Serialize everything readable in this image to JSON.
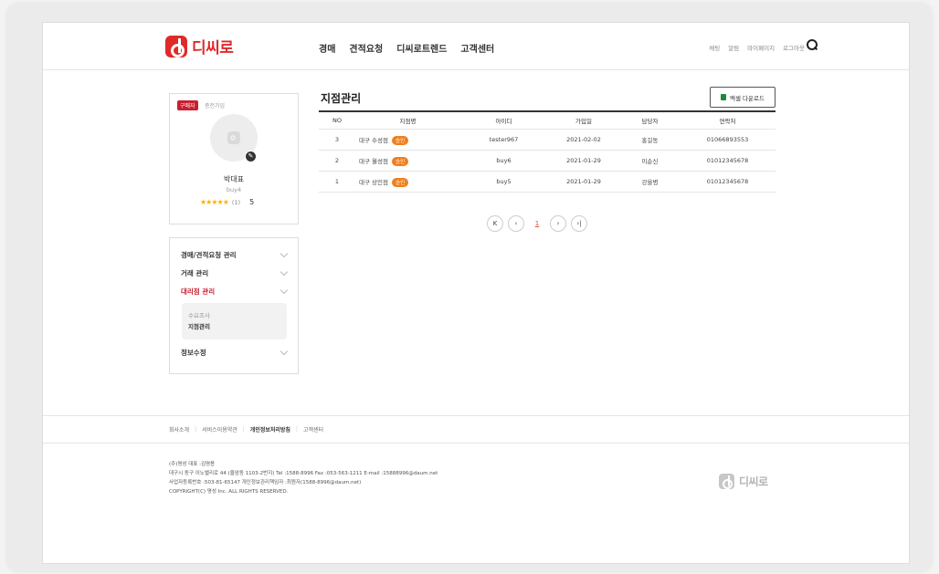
{
  "brand": {
    "name": "디씨로"
  },
  "nav": {
    "items": [
      "경매",
      "견적요청",
      "디씨로트렌드",
      "고객센터"
    ]
  },
  "util": {
    "items": [
      "채팅",
      "알림",
      "마이페이지",
      "로그아웃"
    ]
  },
  "profile": {
    "badge": "구매자",
    "type": "종전가입",
    "name": "박대표",
    "id": "buy4",
    "stars": "★★★★★",
    "rating_count": "(1)",
    "rating_score": "5"
  },
  "sidemenu": {
    "items": [
      {
        "label": "경매/견적요청 관리"
      },
      {
        "label": "거래 관리"
      },
      {
        "label": "대리점 관리"
      },
      {
        "label": "정보수정"
      }
    ],
    "sub": [
      "수요조사",
      "지점관리"
    ]
  },
  "main": {
    "title": "지점관리",
    "excel_label": "엑셀 다운로드",
    "approve_label": "승인",
    "columns": [
      "NO",
      "지점명",
      "아이디",
      "가입일",
      "담당자",
      "연락처"
    ],
    "rows": [
      {
        "no": "3",
        "name": "대구 수성점",
        "id": "tester967",
        "date": "2021-02-02",
        "manager": "홍길동",
        "tel": "01066893553"
      },
      {
        "no": "2",
        "name": "대구 월성점",
        "id": "buy6",
        "date": "2021-01-29",
        "manager": "이순신",
        "tel": "01012345678"
      },
      {
        "no": "1",
        "name": "대구 상인점",
        "id": "buy5",
        "date": "2021-01-29",
        "manager": "강을병",
        "tel": "01012345678"
      }
    ],
    "pager": {
      "first": "K",
      "prev": "‹",
      "current": "1",
      "next": "›",
      "last": "›|"
    }
  },
  "footer": {
    "links": [
      "회사소개",
      "서비스이용약관",
      "개인정보처리방침",
      "고객센터"
    ],
    "info": [
      "(주)명성    대표 :김명용",
      "대구시 동구 이노밸리로 44 (율암동 1103-2번지)   Tel :1588-8996   Fax :053-563-1211   E-mail :15888996@daum.net",
      "사업자등록번호 :503-81-65147    개인정보관리책임자 :최원자(1588-8996@daum.net)",
      "COPYRIGHT(C) 명성 Inc. ALL RIGHTS RESERVED."
    ]
  }
}
